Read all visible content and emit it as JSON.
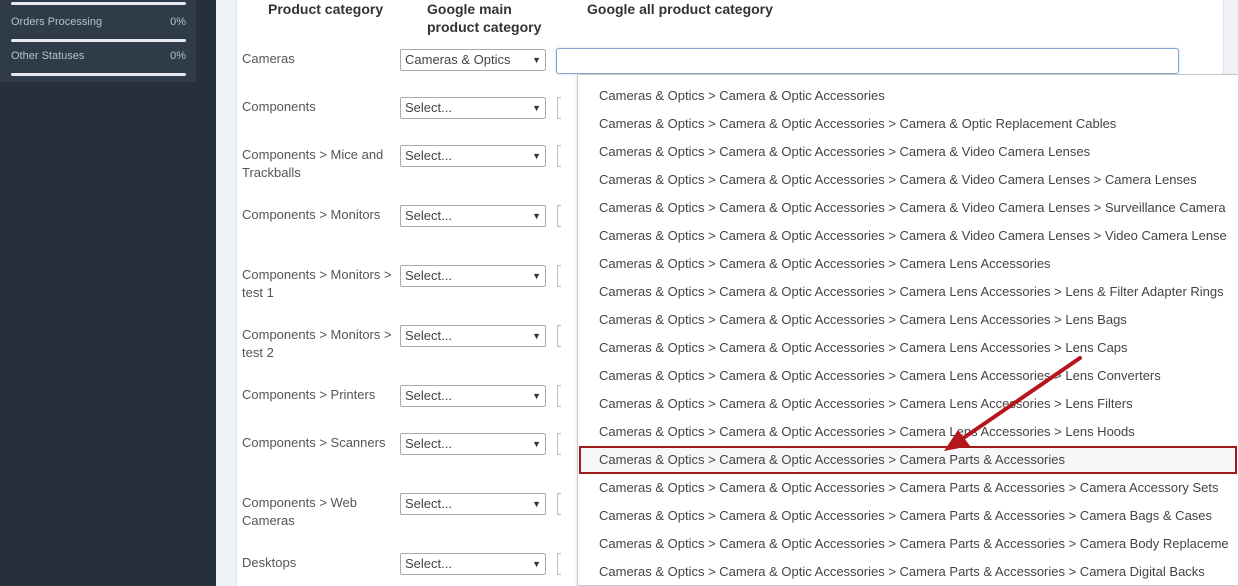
{
  "sidebar": {
    "statuses": [
      {
        "label": "Orders Processing",
        "percent": "0%"
      },
      {
        "label": "Other Statuses",
        "percent": "0%"
      }
    ]
  },
  "table": {
    "headers": {
      "product_category": "Product category",
      "google_main": "Google main product category",
      "google_all": "Google all product category"
    },
    "rows": [
      {
        "category": "Cameras",
        "main_value": "Cameras & Optics"
      },
      {
        "category": "Components",
        "main_value": "Select..."
      },
      {
        "category": "Components  >  Mice and Trackballs",
        "main_value": "Select..."
      },
      {
        "category": "Components  >  Monitors",
        "main_value": "Select..."
      },
      {
        "category": "Components  >  Monitors  >  test 1",
        "main_value": "Select..."
      },
      {
        "category": "Components  >  Monitors  >  test 2",
        "main_value": "Select..."
      },
      {
        "category": "Components  >  Printers",
        "main_value": "Select..."
      },
      {
        "category": "Components  >  Scanners",
        "main_value": "Select..."
      },
      {
        "category": "Components  >  Web Cameras",
        "main_value": "Select..."
      },
      {
        "category": "Desktops",
        "main_value": "Select..."
      }
    ]
  },
  "google_all_input": {
    "value": ""
  },
  "dropdown": {
    "highlighted_index": 13,
    "options": [
      "Cameras & Optics > Camera & Optic Accessories",
      "Cameras & Optics > Camera & Optic Accessories > Camera & Optic Replacement Cables",
      "Cameras & Optics > Camera & Optic Accessories > Camera & Video Camera Lenses",
      "Cameras & Optics > Camera & Optic Accessories > Camera & Video Camera Lenses > Camera Lenses",
      "Cameras & Optics > Camera & Optic Accessories > Camera & Video Camera Lenses > Surveillance Camera",
      "Cameras & Optics > Camera & Optic Accessories > Camera & Video Camera Lenses > Video Camera Lense",
      "Cameras & Optics > Camera & Optic Accessories > Camera Lens Accessories",
      "Cameras & Optics > Camera & Optic Accessories > Camera Lens Accessories > Lens & Filter Adapter Rings",
      "Cameras & Optics > Camera & Optic Accessories > Camera Lens Accessories > Lens Bags",
      "Cameras & Optics > Camera & Optic Accessories > Camera Lens Accessories > Lens Caps",
      "Cameras & Optics > Camera & Optic Accessories > Camera Lens Accessories > Lens Converters",
      "Cameras & Optics > Camera & Optic Accessories > Camera Lens Accessories > Lens Filters",
      "Cameras & Optics > Camera & Optic Accessories > Camera Lens Accessories > Lens Hoods",
      "Cameras & Optics > Camera & Optic Accessories > Camera Parts & Accessories",
      "Cameras & Optics > Camera & Optic Accessories > Camera Parts & Accessories > Camera Accessory Sets",
      "Cameras & Optics > Camera & Optic Accessories > Camera Parts & Accessories > Camera Bags & Cases",
      "Cameras & Optics > Camera & Optic Accessories > Camera Parts & Accessories > Camera Body Replaceme",
      "Cameras & Optics > Camera & Optic Accessories > Camera Parts & Accessories > Camera Digital Backs"
    ]
  },
  "colors": {
    "sidebar_bg": "#25303b",
    "highlight_border": "#a01a1a",
    "annotation_arrow": "#b5161b"
  },
  "icons": {
    "select_arrow": "triangle-down-icon",
    "annotation": "red-arrow-icon"
  }
}
